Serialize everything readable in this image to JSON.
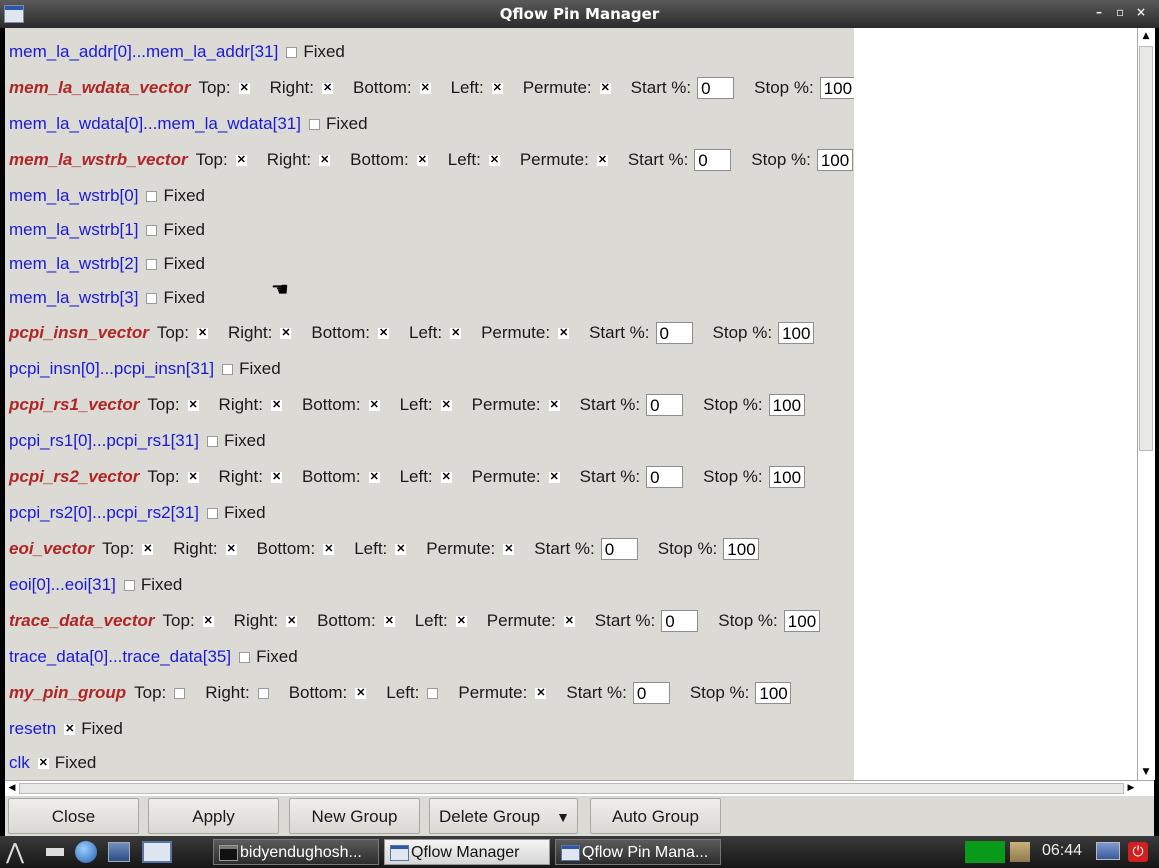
{
  "window": {
    "title": "Qflow Pin Manager",
    "controls": {
      "minimize": "–",
      "maximize": "▫",
      "close": "×"
    }
  },
  "labels": {
    "top": "Top:",
    "right": "Right:",
    "bottom": "Bottom:",
    "left": "Left:",
    "permute": "Permute:",
    "start": "Start %:",
    "stop": "Stop %:",
    "fixed": "Fixed"
  },
  "rows": [
    {
      "type": "pin",
      "name": "mem_la_addr[0]...mem_la_addr[31]",
      "fixed": false
    },
    {
      "type": "group",
      "name": "mem_la_wdata_vector",
      "top": true,
      "right": true,
      "bottom": true,
      "left": true,
      "permute": true,
      "start": "0",
      "stop": "100"
    },
    {
      "type": "pin",
      "name": "mem_la_wdata[0]...mem_la_wdata[31]",
      "fixed": false
    },
    {
      "type": "group",
      "name": "mem_la_wstrb_vector",
      "top": true,
      "right": true,
      "bottom": true,
      "left": true,
      "permute": true,
      "start": "0",
      "stop": "100"
    },
    {
      "type": "pin",
      "name": "mem_la_wstrb[0]",
      "fixed": false
    },
    {
      "type": "pin",
      "name": "mem_la_wstrb[1]",
      "fixed": false
    },
    {
      "type": "pin",
      "name": "mem_la_wstrb[2]",
      "fixed": false
    },
    {
      "type": "pin",
      "name": "mem_la_wstrb[3]",
      "fixed": false
    },
    {
      "type": "group",
      "name": "pcpi_insn_vector",
      "top": true,
      "right": true,
      "bottom": true,
      "left": true,
      "permute": true,
      "start": "0",
      "stop": "100"
    },
    {
      "type": "pin",
      "name": "pcpi_insn[0]...pcpi_insn[31]",
      "fixed": false
    },
    {
      "type": "group",
      "name": "pcpi_rs1_vector",
      "top": true,
      "right": true,
      "bottom": true,
      "left": true,
      "permute": true,
      "start": "0",
      "stop": "100"
    },
    {
      "type": "pin",
      "name": "pcpi_rs1[0]...pcpi_rs1[31]",
      "fixed": false
    },
    {
      "type": "group",
      "name": "pcpi_rs2_vector",
      "top": true,
      "right": true,
      "bottom": true,
      "left": true,
      "permute": true,
      "start": "0",
      "stop": "100"
    },
    {
      "type": "pin",
      "name": "pcpi_rs2[0]...pcpi_rs2[31]",
      "fixed": false
    },
    {
      "type": "group",
      "name": "eoi_vector",
      "top": true,
      "right": true,
      "bottom": true,
      "left": true,
      "permute": true,
      "start": "0",
      "stop": "100"
    },
    {
      "type": "pin",
      "name": "eoi[0]...eoi[31]",
      "fixed": false
    },
    {
      "type": "group",
      "name": "trace_data_vector",
      "top": true,
      "right": true,
      "bottom": true,
      "left": true,
      "permute": true,
      "start": "0",
      "stop": "100"
    },
    {
      "type": "pin",
      "name": "trace_data[0]...trace_data[35]",
      "fixed": false
    },
    {
      "type": "group",
      "name": "my_pin_group",
      "top": false,
      "right": false,
      "bottom": true,
      "left": false,
      "permute": true,
      "start": "0",
      "stop": "100"
    },
    {
      "type": "pin",
      "name": "resetn",
      "fixed": true
    },
    {
      "type": "pin",
      "name": "clk",
      "fixed": true
    }
  ],
  "buttons": {
    "close": "Close",
    "apply": "Apply",
    "new_group": "New Group",
    "delete_group": "Delete Group",
    "dropdown_arrow": "▼",
    "auto_group": "Auto Group"
  },
  "taskbar": {
    "items": [
      {
        "label": "bidyendughosh...",
        "icon": "terminal-icon",
        "active": false
      },
      {
        "label": "Qflow Manager",
        "icon": "window-icon",
        "active": true
      },
      {
        "label": "Qflow Pin Mana...",
        "icon": "window-icon",
        "active": false
      }
    ],
    "clock": "06:44"
  },
  "colors": {
    "pin_text": "#1a1ad6",
    "group_text": "#b02525",
    "panel_bg": "#dcdad5"
  }
}
